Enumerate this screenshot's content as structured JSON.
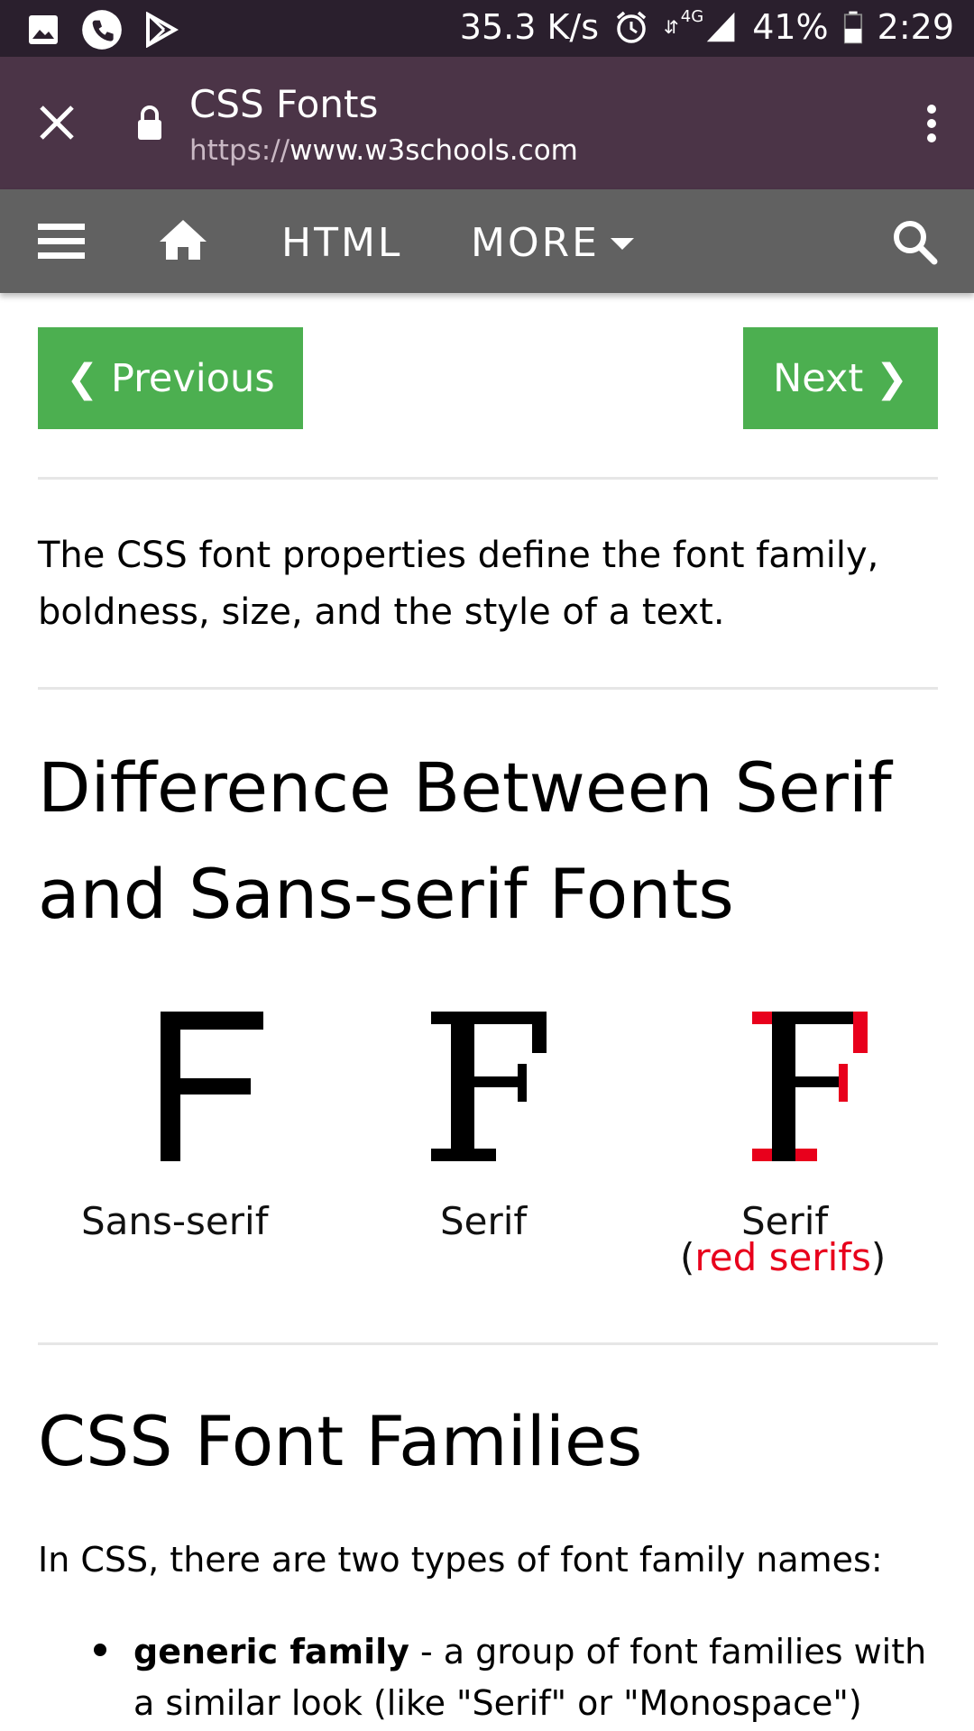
{
  "status_bar": {
    "speed": "35.3 K/s",
    "network": "4G",
    "battery": "41%",
    "time": "2:29"
  },
  "browser": {
    "page_title": "CSS Fonts",
    "url_protocol": "https://",
    "url_host": "www.w3schools.com"
  },
  "navbar": {
    "html_label": "HTML",
    "more_label": "MORE"
  },
  "pager": {
    "previous_label": "❮ Previous",
    "next_label": "Next ❯"
  },
  "article": {
    "intro": "The CSS font properties define the font family, boldness, size, and the style of a text.",
    "heading1": "Difference Between Serif and Sans-serif Fonts",
    "figure": {
      "letter": "F",
      "sans_caption": "Sans-serif",
      "serif_caption": "Serif",
      "serif_red_caption": "Serif",
      "serif_red_note_open": "(",
      "serif_red_note": "red serifs",
      "serif_red_note_close": ")"
    },
    "heading2": "CSS Font Families",
    "para": "In CSS, there are two types of font family names:",
    "bullet_bold": "generic family",
    "bullet_text": " - a group of font families with a similar look (like \"Serif\" or \"Monospace\")"
  },
  "colors": {
    "status_bar_bg": "#2a1f2d",
    "chrome_bg": "#4b3447",
    "navbar_bg": "#616161",
    "button_green": "#4caf50",
    "serif_red": "#e8001c"
  }
}
